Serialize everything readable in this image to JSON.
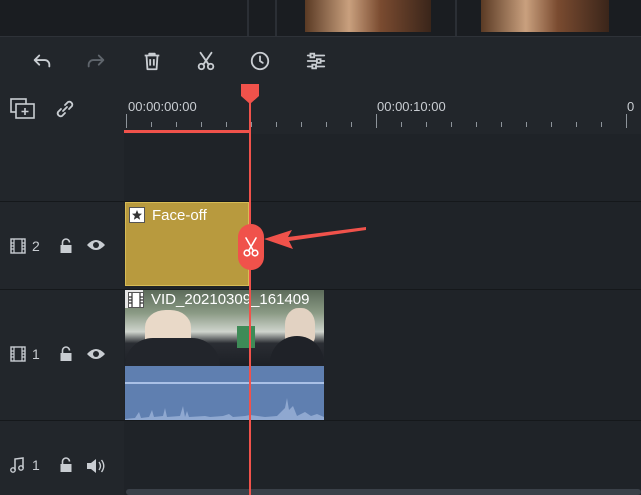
{
  "toolbar": {
    "undo_icon": "undo-icon",
    "redo_icon": "redo-icon",
    "delete_icon": "trash-icon",
    "cut_icon": "scissors-icon",
    "speed_icon": "clock-icon",
    "adjust_icon": "sliders-icon"
  },
  "ruler": {
    "timecodes": [
      "00:00:00:00",
      "00:00:10:00"
    ]
  },
  "tracks": [
    {
      "type": "title",
      "number": "2",
      "clip_name": "Face-off"
    },
    {
      "type": "video",
      "number": "1",
      "clip_name": "VID_20210309_161409"
    },
    {
      "type": "audio",
      "number": "1"
    }
  ],
  "colors": {
    "playhead": "#f0524b",
    "title_clip": "#b89a3e",
    "video_clip": "#3b4a66"
  }
}
